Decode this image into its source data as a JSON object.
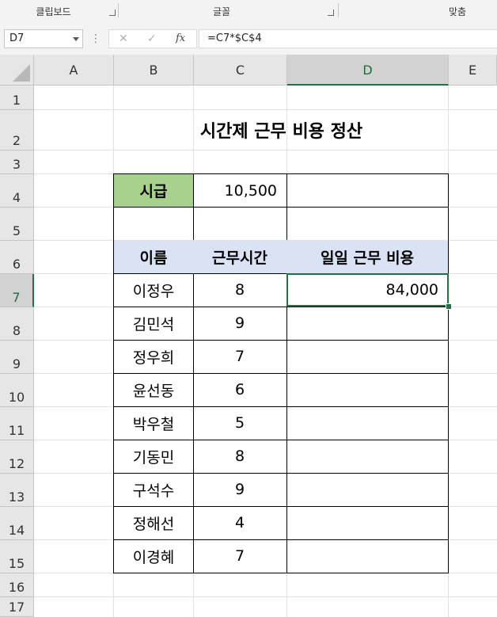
{
  "ribbon": {
    "groups": [
      "클립보드",
      "글꼴",
      "맞춤"
    ]
  },
  "formula_bar": {
    "name_box": "D7",
    "dots": "⋮",
    "cancel_icon": "✕",
    "enter_icon": "✓",
    "fx_icon": "fx",
    "formula": "=C7*$C$4"
  },
  "columns": [
    "A",
    "B",
    "C",
    "D",
    "E"
  ],
  "rows": [
    "1",
    "2",
    "3",
    "4",
    "5",
    "6",
    "7",
    "8",
    "9",
    "10",
    "11",
    "12",
    "13",
    "14",
    "15",
    "16",
    "17"
  ],
  "sheet": {
    "title": "시간제 근무 비용 정산",
    "wage_label": "시급",
    "wage_value": "10,500",
    "headers": {
      "name": "이름",
      "hours": "근무시간",
      "cost": "일일 근무 비용"
    },
    "employees": [
      {
        "name": "이정우",
        "hours": "8",
        "cost": "84,000"
      },
      {
        "name": "김민석",
        "hours": "9",
        "cost": ""
      },
      {
        "name": "정우희",
        "hours": "7",
        "cost": ""
      },
      {
        "name": "윤선동",
        "hours": "6",
        "cost": ""
      },
      {
        "name": "박우철",
        "hours": "5",
        "cost": ""
      },
      {
        "name": "기동민",
        "hours": "8",
        "cost": ""
      },
      {
        "name": "구석수",
        "hours": "9",
        "cost": ""
      },
      {
        "name": "정해선",
        "hours": "4",
        "cost": ""
      },
      {
        "name": "이경혜",
        "hours": "7",
        "cost": ""
      }
    ]
  },
  "colors": {
    "wage_label_fill": "#a9d18e",
    "header_fill": "#dae3f3",
    "selection": "#217346"
  }
}
